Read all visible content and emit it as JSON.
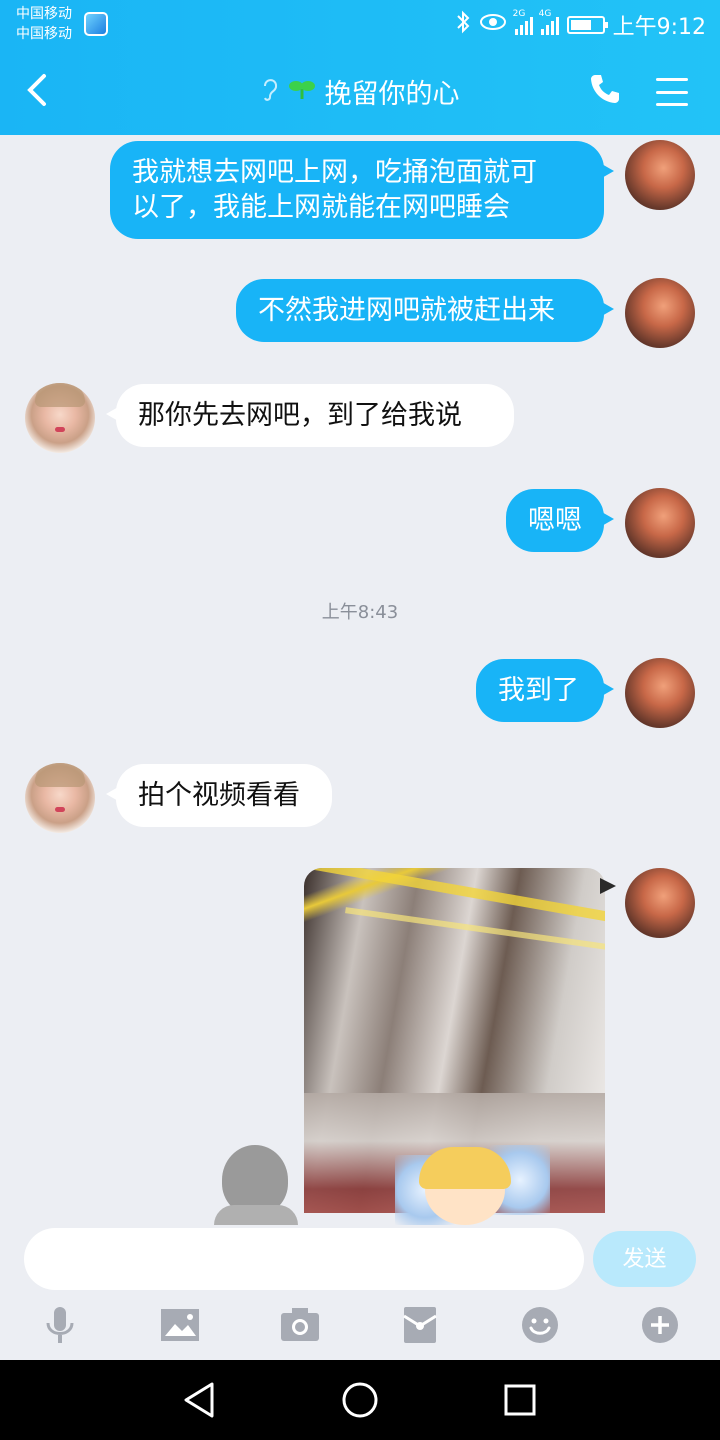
{
  "status_bar": {
    "carrier_1": "中国移动",
    "carrier_2": "中国移动",
    "signal_1_label": "2G",
    "signal_2_label": "4G",
    "time": "上午9:12"
  },
  "header": {
    "title": "挽留你的心",
    "back_icon": "chevron-left-icon",
    "call_icon": "phone-icon",
    "menu_icon": "menu-icon"
  },
  "messages": [
    {
      "from": "me",
      "lines": [
        "我就想去网吧上网，吃捅泡面就可",
        "以了，我能上网就能在网吧睡会"
      ]
    },
    {
      "from": "me",
      "text": "不然我进网吧就被赶出来"
    },
    {
      "from": "her",
      "text": "那你先去网吧，到了给我说"
    },
    {
      "from": "me",
      "text": "嗯嗯"
    },
    {
      "timestamp": "上午8:43"
    },
    {
      "from": "me",
      "text": "我到了"
    },
    {
      "from": "her",
      "text": "拍个视频看看"
    },
    {
      "from": "me",
      "type": "video"
    }
  ],
  "input": {
    "value": "",
    "placeholder": "",
    "send_label": "发送"
  },
  "toolbar_icons": [
    "microphone-icon",
    "image-icon",
    "camera-icon",
    "red-packet-icon",
    "emoji-icon",
    "plus-icon"
  ],
  "colors": {
    "header": "#1ab5f5",
    "outgoing_bubble": "#18b4f7",
    "incoming_bubble": "#ffffff",
    "background": "#eceef3"
  }
}
